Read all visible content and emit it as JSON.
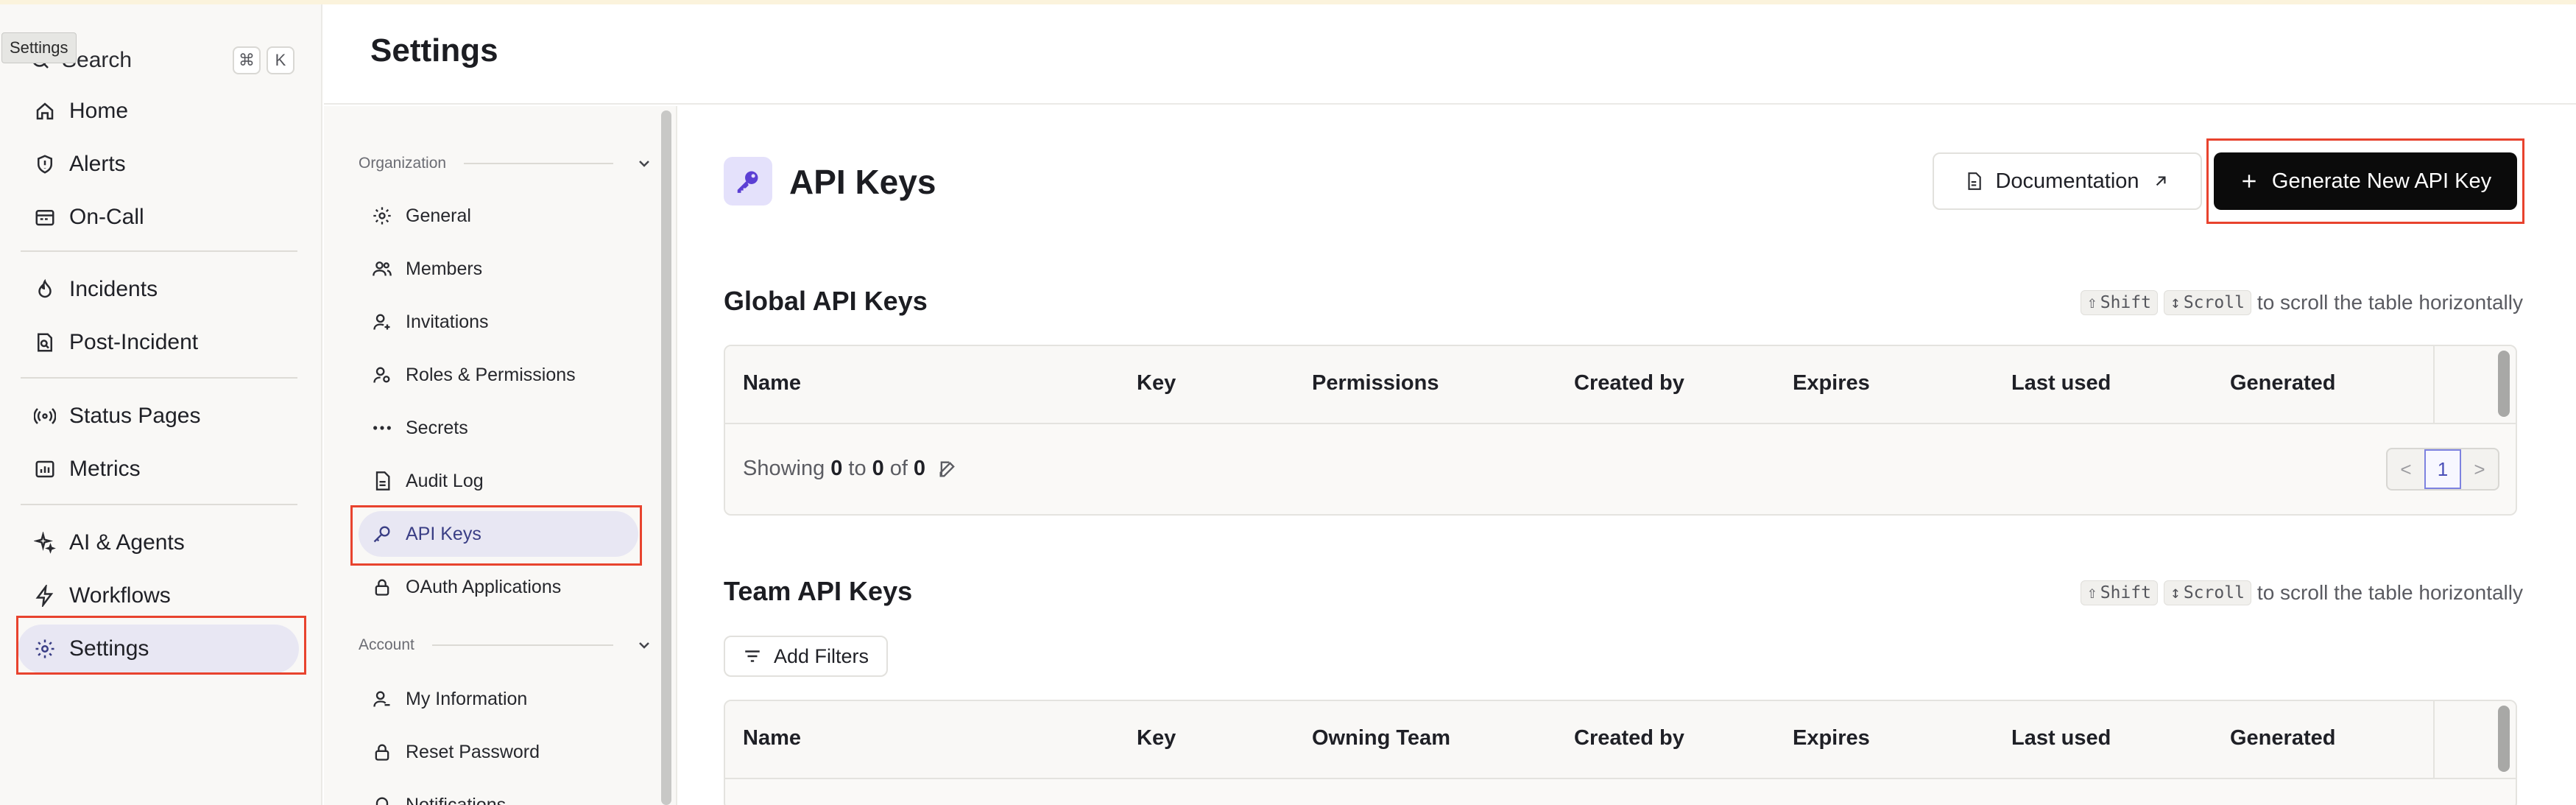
{
  "tooltip": "Settings",
  "sidebar": {
    "search_label": "Search",
    "search_keys": [
      "⌘",
      "K"
    ],
    "items": [
      {
        "label": "Home",
        "icon": "home-icon"
      },
      {
        "label": "Alerts",
        "icon": "alert-icon"
      },
      {
        "label": "On-Call",
        "icon": "calendar-icon"
      },
      {
        "label": "Incidents",
        "icon": "flame-icon"
      },
      {
        "label": "Post-Incident",
        "icon": "document-search-icon"
      },
      {
        "label": "Status Pages",
        "icon": "broadcast-icon"
      },
      {
        "label": "Metrics",
        "icon": "chart-icon"
      },
      {
        "label": "AI & Agents",
        "icon": "sparkle-icon"
      },
      {
        "label": "Workflows",
        "icon": "bolt-icon"
      },
      {
        "label": "Settings",
        "icon": "gear-icon",
        "active": true
      }
    ]
  },
  "header": {
    "title": "Settings"
  },
  "subnav": {
    "org_section": "Organization",
    "org_items": [
      {
        "label": "General",
        "icon": "gear-icon"
      },
      {
        "label": "Members",
        "icon": "users-icon"
      },
      {
        "label": "Invitations",
        "icon": "user-plus-icon"
      },
      {
        "label": "Roles & Permissions",
        "icon": "user-key-icon"
      },
      {
        "label": "Secrets",
        "icon": "dots-icon"
      },
      {
        "label": "Audit Log",
        "icon": "file-icon"
      },
      {
        "label": "API Keys",
        "icon": "key-icon",
        "active": true
      },
      {
        "label": "OAuth Applications",
        "icon": "lock-icon"
      }
    ],
    "account_section": "Account",
    "account_items": [
      {
        "label": "My Information",
        "icon": "user-icon"
      },
      {
        "label": "Reset Password",
        "icon": "lock-icon"
      },
      {
        "label": "Notifications",
        "icon": "bell-icon"
      }
    ]
  },
  "content": {
    "page_title": "API Keys",
    "documentation_label": "Documentation",
    "generate_label": "Generate New API Key",
    "hint": {
      "shift": "Shift",
      "scroll": "Scroll",
      "text": "to scroll the table horizontally"
    },
    "global": {
      "title": "Global API Keys",
      "columns": [
        "Name",
        "Key",
        "Permissions",
        "Created by",
        "Expires",
        "Last used",
        "Generated"
      ],
      "showing_prefix": "Showing",
      "from": "0",
      "to_word": "to",
      "to": "0",
      "of_word": "of",
      "total": "0",
      "pager": {
        "prev": "<",
        "page": "1",
        "next": ">"
      }
    },
    "team": {
      "title": "Team API Keys",
      "add_filters": "Add Filters",
      "columns": [
        "Name",
        "Key",
        "Owning Team",
        "Created by",
        "Expires",
        "Last used",
        "Generated"
      ]
    }
  },
  "colors": {
    "accent": "#e8432e",
    "active_bg": "#e8e7f3",
    "primary_btn": "#0b0b0b",
    "key_icon": "#5b3fd4"
  }
}
